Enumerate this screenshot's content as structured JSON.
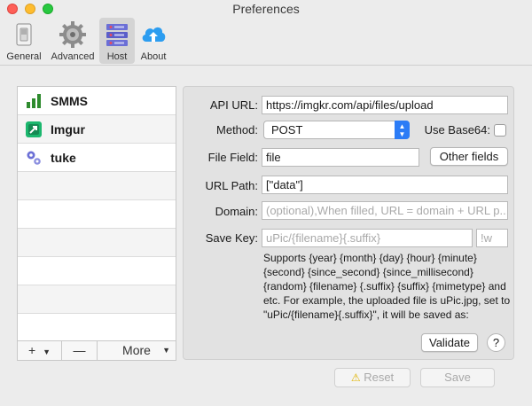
{
  "window": {
    "title": "Preferences"
  },
  "toolbar": {
    "items": [
      {
        "label": "General"
      },
      {
        "label": "Advanced"
      },
      {
        "label": "Host"
      },
      {
        "label": "About"
      }
    ]
  },
  "hosts": {
    "items": [
      {
        "label": "SMMS",
        "icon": "bar-chart-icon"
      },
      {
        "label": "Imgur",
        "icon": "imgur-icon"
      },
      {
        "label": "tuke",
        "icon": "gears-icon"
      }
    ],
    "add_label": "+",
    "remove_label": "—",
    "more_label": "More"
  },
  "form": {
    "api_url_label": "API URL:",
    "api_url_value": "https://imgkr.com/api/files/upload",
    "method_label": "Method:",
    "method_value": "POST",
    "base64_label": "Use Base64:",
    "file_field_label": "File Field:",
    "file_field_value": "file",
    "other_fields_label": "Other fields",
    "url_path_label": "URL Path:",
    "url_path_value": "[\"data\"]",
    "domain_label": "Domain:",
    "domain_placeholder": "(optional),When filled, URL = domain + URL p...",
    "save_key_label": "Save Key:",
    "save_key_placeholder": "uPic/{filename}{.suffix}",
    "suffix_placeholder": "!w",
    "description": "Supports {year} {month} {day} {hour} {minute} {second} {since_second} {since_millisecond} {random} {filename} {.suffix} {suffix} {mimetype} and etc. For example, the uploaded file is uPic.jpg, set to \"uPic/{filename}{.suffix}\", it will be saved as:",
    "validate_label": "Validate",
    "help_label": "?"
  },
  "footer": {
    "reset_label": "Reset",
    "save_label": "Save"
  },
  "colors": {
    "accent": "#2c7cf6",
    "smms_green": "#2e8b2e",
    "imgur_green": "#1bb76e",
    "tuke_purple": "#6b6fd6"
  }
}
